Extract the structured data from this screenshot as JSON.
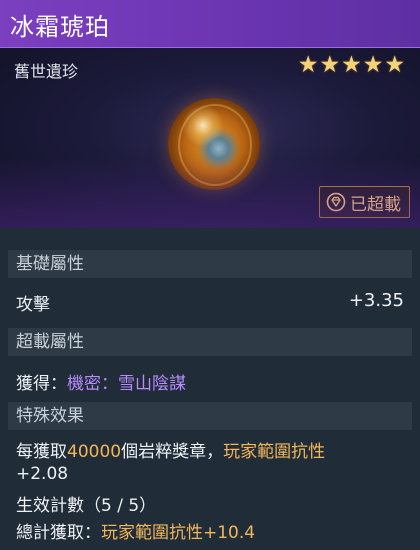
{
  "item": {
    "name": "冰霜琥珀",
    "rarity": "舊世遺珍",
    "stars": "★★★★★",
    "overcharge_label": "已超載"
  },
  "sections": {
    "base_attrs": {
      "header": "基礎屬性",
      "stat_label": "攻擊",
      "stat_value": "+3.35"
    },
    "overcharge_attrs": {
      "header": "超載屬性",
      "obtain_prefix": "獲得：",
      "obtain_value": "機密：雪山陰謀"
    },
    "special": {
      "header": "特殊效果",
      "line1_a": "每獲取",
      "line1_num": "40000",
      "line1_b": "個岩粹獎章，",
      "line1_c": "玩家範圍抗性",
      "line2": "+2.08",
      "line3": "生效計數（5 / 5）",
      "line4_prefix": "總計獲取：",
      "line4_value": "玩家範圍抗性+10.4"
    }
  },
  "colors": {
    "header_purple": "#7b3fc0",
    "star_gold": "#f4d27a",
    "highlight_orange": "#f2b75a",
    "link_purple": "#b98bff"
  },
  "icons": {
    "overcharge": "diamond-badge-icon",
    "item": "amber-orb-image"
  }
}
